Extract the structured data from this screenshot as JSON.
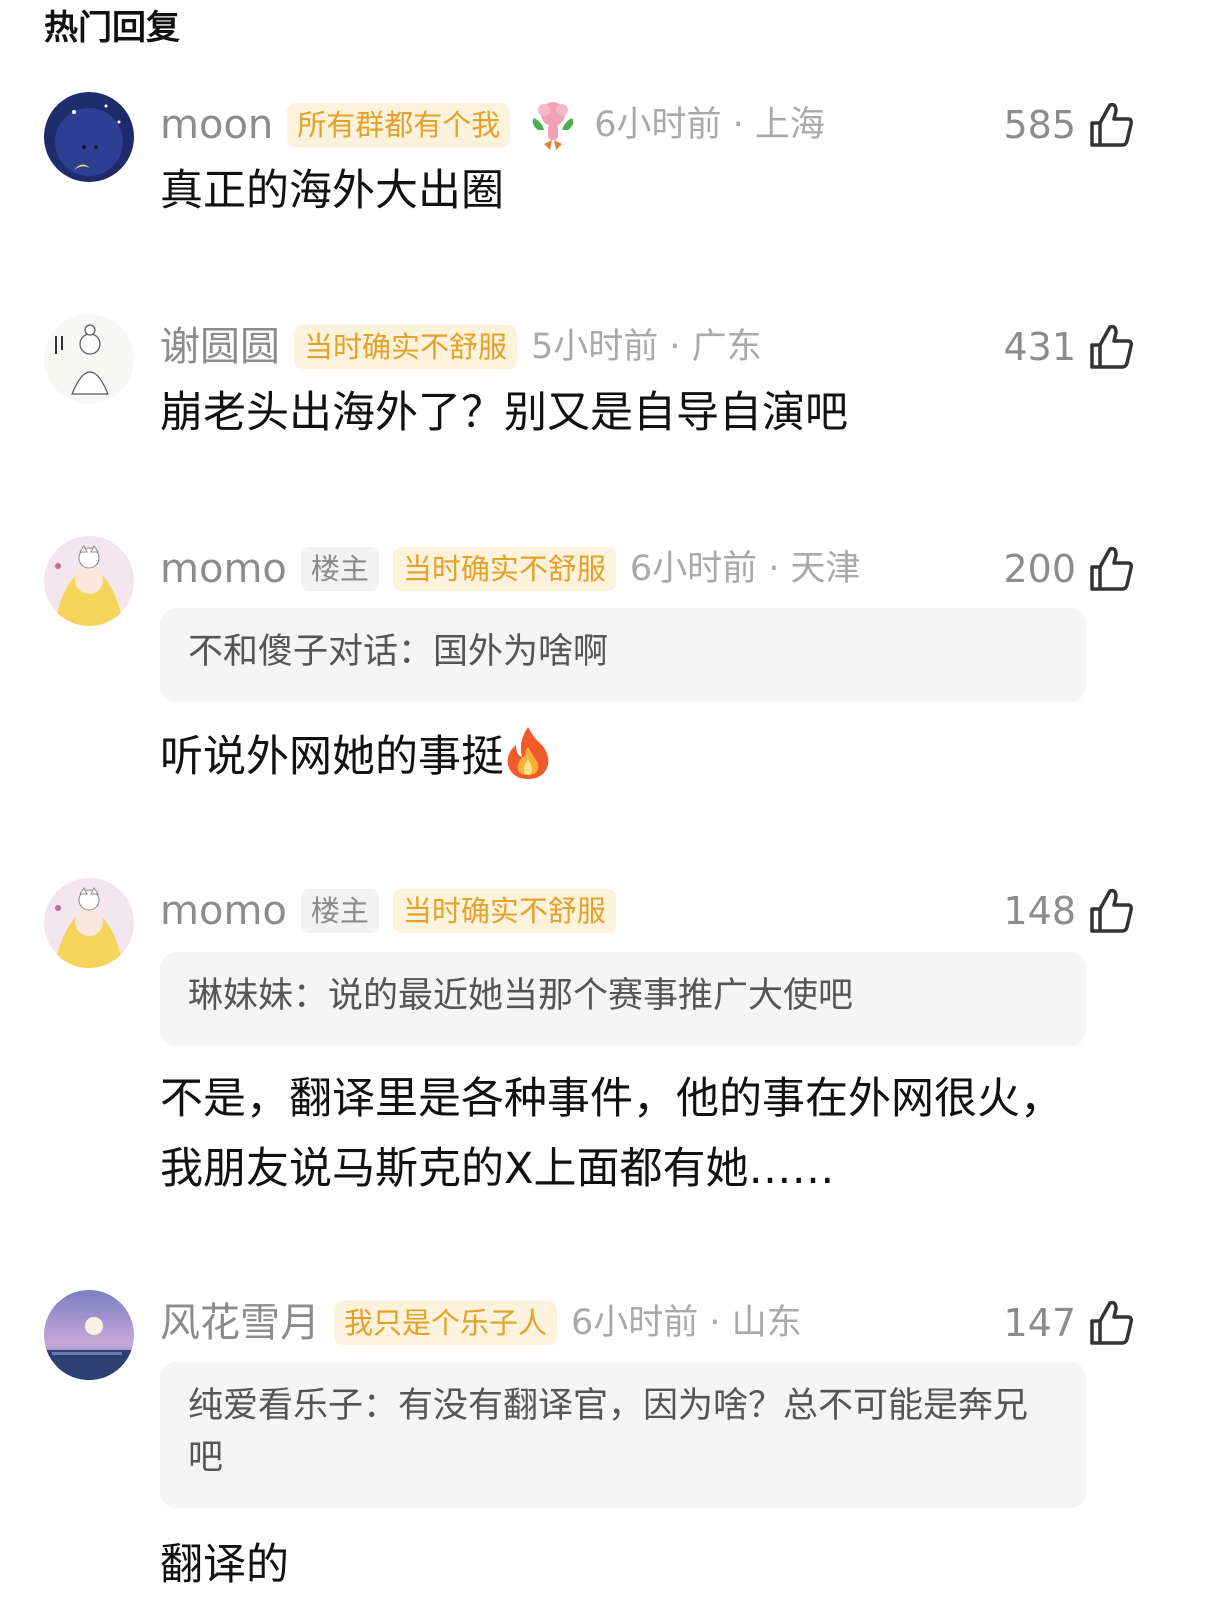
{
  "section_title": "热门回复",
  "colors": {
    "fan_badge_text": "#e3a22a",
    "fan_badge_bg": "#fdf2dc",
    "meta_gray": "#a9a9a9",
    "quote_bg": "#f5f5f5"
  },
  "comments": [
    {
      "username": "moon",
      "fan_badge": "所有群都有个我",
      "time_location": "6小时前 · 上海",
      "likes": "585",
      "text": "真正的海外大出圈"
    },
    {
      "username": "谢圆圆",
      "fan_badge": "当时确实不舒服",
      "time_location": "5小时前 · 广东",
      "likes": "431",
      "text": "崩老头出海外了？别又是自导自演吧"
    },
    {
      "username": "momo",
      "op_badge": "楼主",
      "fan_badge": "当时确实不舒服",
      "time_location": "6小时前 · 天津",
      "likes": "200",
      "quote_name": "不和傻子对话：",
      "quote_text": "国外为啥啊",
      "text": "听说外网她的事挺",
      "text_emoji": "fire-icon"
    },
    {
      "username": "momo",
      "op_badge": "楼主",
      "fan_badge": "当时确实不舒服",
      "likes": "148",
      "quote_name": "琳妹妹：",
      "quote_text": "说的最近她当那个赛事推广大使吧",
      "text": "不是，翻译里是各种事件，他的事在外网很火，我朋友说马斯克的X上面都有她……"
    },
    {
      "username": "风花雪月",
      "fan_badge": "我只是个乐子人",
      "time_location": "6小时前 · 山东",
      "likes": "147",
      "quote_name": "纯爱看乐子：",
      "quote_text": "有没有翻译官，因为啥？总不可能是奔兄吧",
      "text": "翻译的"
    }
  ]
}
